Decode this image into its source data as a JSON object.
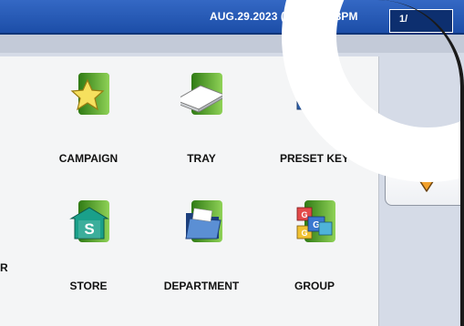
{
  "header": {
    "datetime": "AUG.29.2023 (TUE)  11:03PM",
    "page_indicator": "1/"
  },
  "menu": {
    "partial_label": "R",
    "items": [
      {
        "label": "CAMPAIGN",
        "icon": "star-icon"
      },
      {
        "label": "TRAY",
        "icon": "tray-icon"
      },
      {
        "label": "PRESET KEY",
        "icon": "preset-key-icon"
      },
      {
        "label": "STORE",
        "icon": "store-icon"
      },
      {
        "label": "DEPARTMENT",
        "icon": "folder-icon"
      },
      {
        "label": "GROUP",
        "icon": "group-icon"
      }
    ]
  },
  "colors": {
    "header_bg": "#1c4ea8",
    "tile_green": "#5aa42c",
    "arrow_orange": "#f2a12b"
  }
}
